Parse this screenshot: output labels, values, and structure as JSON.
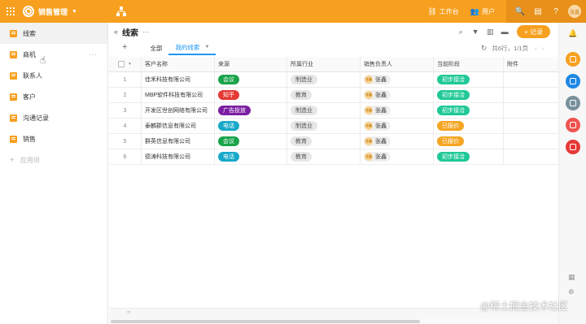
{
  "topbar": {
    "app_title": "销售管理",
    "workbench_label": "工作台",
    "users_label": "用户",
    "avatar_text": "张鑫",
    "color": "#f7a01f"
  },
  "sidebar": {
    "items": [
      {
        "label": "线索",
        "active": true
      },
      {
        "label": "商机",
        "active": false,
        "more": "···"
      },
      {
        "label": "联系人",
        "active": false
      },
      {
        "label": "客户",
        "active": false
      },
      {
        "label": "沟通记录",
        "active": false
      },
      {
        "label": "销售",
        "active": false
      }
    ],
    "add_label": "应用项"
  },
  "view": {
    "title": "线索",
    "more": "···",
    "add_button": "+ 记录",
    "tabs": [
      {
        "label": "全部"
      },
      {
        "label": "我的线索",
        "active": true
      }
    ],
    "pagination": "共6行，1/1页"
  },
  "table": {
    "columns": [
      "客户名称",
      "来源",
      "所属行业",
      "销售负责人",
      "当前阶段",
      "附件"
    ],
    "rows": [
      {
        "num": "1",
        "name": "佳禾科技有限公司",
        "source": "会议",
        "source_color": "#1aa34a",
        "industry": "制造业",
        "owner": "张鑫",
        "owner_avatar": "张鑫",
        "stage": "初步接洽",
        "stage_color": "#20c997"
      },
      {
        "num": "2",
        "name": "MBP软件科技有限公司",
        "source": "知乎",
        "source_color": "#e53935",
        "industry": "教育",
        "owner": "张鑫",
        "owner_avatar": "张鑫",
        "stage": "初步接洽",
        "stage_color": "#20c997"
      },
      {
        "num": "3",
        "name": "开发区世创网络有限公司",
        "source": "广告投放",
        "source_color": "#7b1fa2",
        "industry": "制造业",
        "owner": "张鑫",
        "owner_avatar": "张鑫",
        "stage": "初步接洽",
        "stage_color": "#20c997"
      },
      {
        "num": "4",
        "name": "泰麟郡信息有限公司",
        "source": "电话",
        "source_color": "#17a9c9",
        "industry": "制造业",
        "owner": "张鑫",
        "owner_avatar": "张鑫",
        "stage": "已报价",
        "stage_color": "#f5a623"
      },
      {
        "num": "5",
        "name": "群英信息有限公司",
        "source": "会议",
        "source_color": "#1aa34a",
        "industry": "教育",
        "owner": "张鑫",
        "owner_avatar": "张鑫",
        "stage": "已报价",
        "stage_color": "#f5a623"
      },
      {
        "num": "6",
        "name": "德涛科技有限公司",
        "source": "电话",
        "source_color": "#17a9c9",
        "industry": "教育",
        "owner": "张鑫",
        "owner_avatar": "张鑫",
        "stage": "初步接洽",
        "stage_color": "#20c997"
      }
    ],
    "footer_text": "="
  },
  "rail": {
    "apps": [
      {
        "icon": "grid-app-icon",
        "color": "#f7a01f"
      },
      {
        "icon": "org-chart-app-icon",
        "color": "#1e88e5"
      },
      {
        "icon": "user-app-icon",
        "color": "#78909c"
      },
      {
        "icon": "face-app-icon",
        "color": "#ef5350"
      },
      {
        "icon": "calendar-app-icon",
        "color": "#e53935"
      }
    ]
  },
  "watermark": "@稀土掘金技术社区"
}
